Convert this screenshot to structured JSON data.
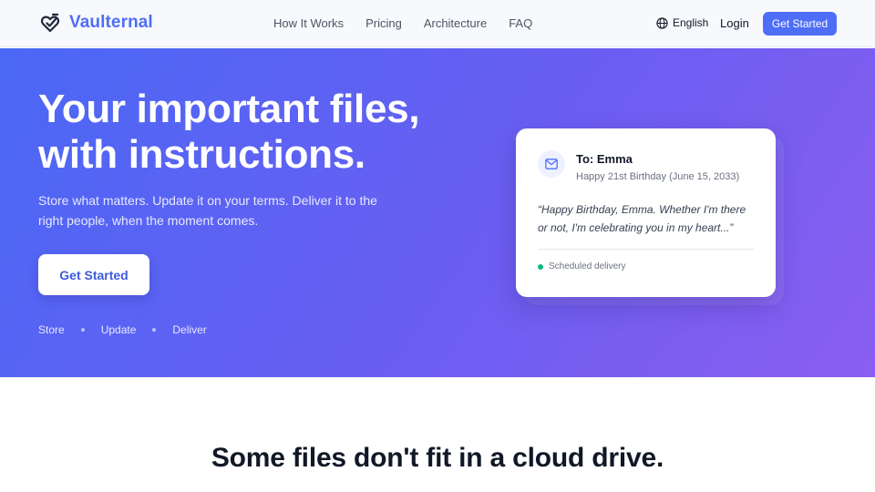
{
  "brand": {
    "name": "Vaulternal",
    "accent": "#4f6ef7"
  },
  "nav": {
    "links": [
      "How It Works",
      "Pricing",
      "Architecture",
      "FAQ"
    ],
    "language": "English",
    "login": "Login",
    "cta": "Get Started",
    "icons": {
      "logo": "heart-shield-icon",
      "language": "globe-icon"
    }
  },
  "hero": {
    "title_line1": "Your important files,",
    "title_line2": "with instructions.",
    "subtitle": "Store what matters. Update it on your terms. Deliver it to the right people, when the moment comes.",
    "cta": "Get Started",
    "steps": [
      "Store",
      "Update",
      "Deliver"
    ],
    "gradient": [
      "#4a68f5",
      "#8a5ef0"
    ]
  },
  "card": {
    "icon": "mail-icon",
    "to": "To: Emma",
    "occasion": "Happy 21st Birthday (June 15, 2033)",
    "message": "“Happy Birthday, Emma. Whether I'm there or not, I'm celebrating you in my heart...”",
    "status": "Scheduled delivery",
    "status_color": "#10b981"
  },
  "section": {
    "title": "Some files don't fit in a cloud drive."
  }
}
